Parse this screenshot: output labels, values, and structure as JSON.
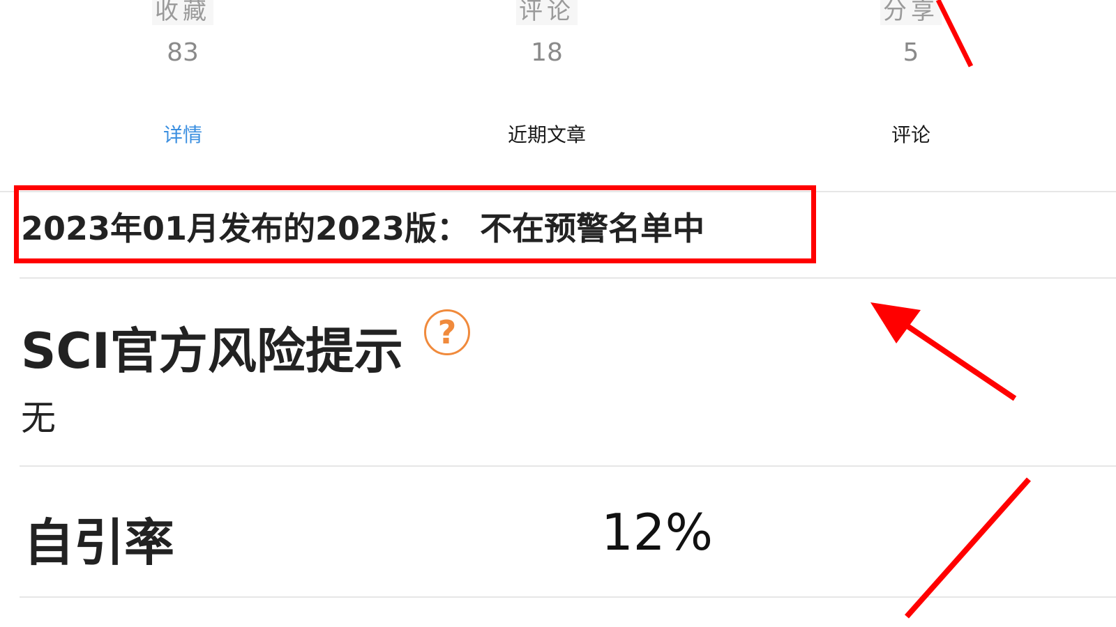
{
  "stats": [
    {
      "label": "收藏",
      "value": "83"
    },
    {
      "label": "评论",
      "value": "18"
    },
    {
      "label": "分享",
      "value": "5"
    }
  ],
  "tabs": [
    {
      "label": "详情",
      "active": true
    },
    {
      "label": "近期文章",
      "active": false
    },
    {
      "label": "评论",
      "active": false
    }
  ],
  "warning": {
    "text": "2023年01月发布的2023版：  不在预警名单中"
  },
  "risk": {
    "title": "SCI官方风险提示",
    "help_icon": "?",
    "value": "无"
  },
  "self_citation": {
    "label": "自引率",
    "value": "12%"
  },
  "colors": {
    "accent": "#3b8fe0",
    "highlight": "#ff0000",
    "help": "#f08a3c"
  }
}
